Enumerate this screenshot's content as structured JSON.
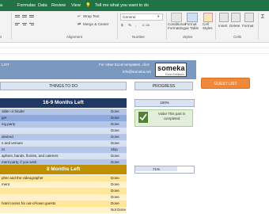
{
  "ribbon": {
    "tabs": [
      "a",
      "Formulas",
      "Data",
      "Review",
      "View"
    ],
    "tell_me": "Tell me what you want to do",
    "wrap_text": "Wrap Text",
    "merge_center": "Merge & Center",
    "number_format": "General",
    "currency_symbol": "$",
    "percent_symbol": "%",
    "comma_symbol": ",",
    "conditional_formatting": "Conditional Formatting",
    "format_as_table": "Format as Table",
    "cell_styles": "Cell Styles",
    "insert": "Insert",
    "delete": "Delete",
    "format": "Format",
    "group_alignment": "Alignment",
    "group_number": "Number",
    "group_styles": "Styles",
    "group_cells": "Cells",
    "group_font_tail": "s"
  },
  "sheet": {
    "list_title_fragment": "LIST",
    "promo_line": "For other Excel templates, click",
    "promo_link": "info@someka.net",
    "logo": "someka",
    "logo_tagline": "Excel Solutions",
    "todo_header": "THINGS TO DO",
    "progress_header": "PROGRESS",
    "guest_list_button": "GUEST LIST"
  },
  "sections": [
    {
      "title": "16-9 Months Left",
      "progress": "100%",
      "message": "Voila! This part is completed",
      "rows": [
        {
          "task": "older or binder",
          "status": "Done"
        },
        {
          "task": "get",
          "status": "Done"
        },
        {
          "task": "ing party",
          "status": "Done"
        },
        {
          "task": "",
          "status": "Done"
        },
        {
          "task": "desired",
          "status": "Done"
        },
        {
          "task": "s and venues",
          "status": "Done"
        },
        {
          "task": "nt",
          "status": "Skip"
        },
        {
          "task": "aphers, bands, florists, and caterers",
          "status": "Done"
        },
        {
          "task": "ment party, if you wish",
          "status": "Done"
        }
      ]
    },
    {
      "title": "8 Months Left",
      "progress": "71%",
      "rows": [
        {
          "task": "pher and the videographer",
          "status": "Done"
        },
        {
          "task": "ment",
          "status": "Done"
        },
        {
          "task": "",
          "status": "Done"
        },
        {
          "task": "",
          "status": "Done"
        },
        {
          "task": "hotel rooms for out-of-town guests",
          "status": "Done"
        },
        {
          "task": "",
          "status": "Not Done"
        }
      ]
    }
  ],
  "colors": {
    "excel_green": "#217346",
    "header_blue": "#7b98bf",
    "section_navy": "#1f3864",
    "section_gold": "#bf8f00",
    "row_blue": "#b4c6e7",
    "row_gold": "#ffe699",
    "accent_orange": "#f0883a"
  }
}
